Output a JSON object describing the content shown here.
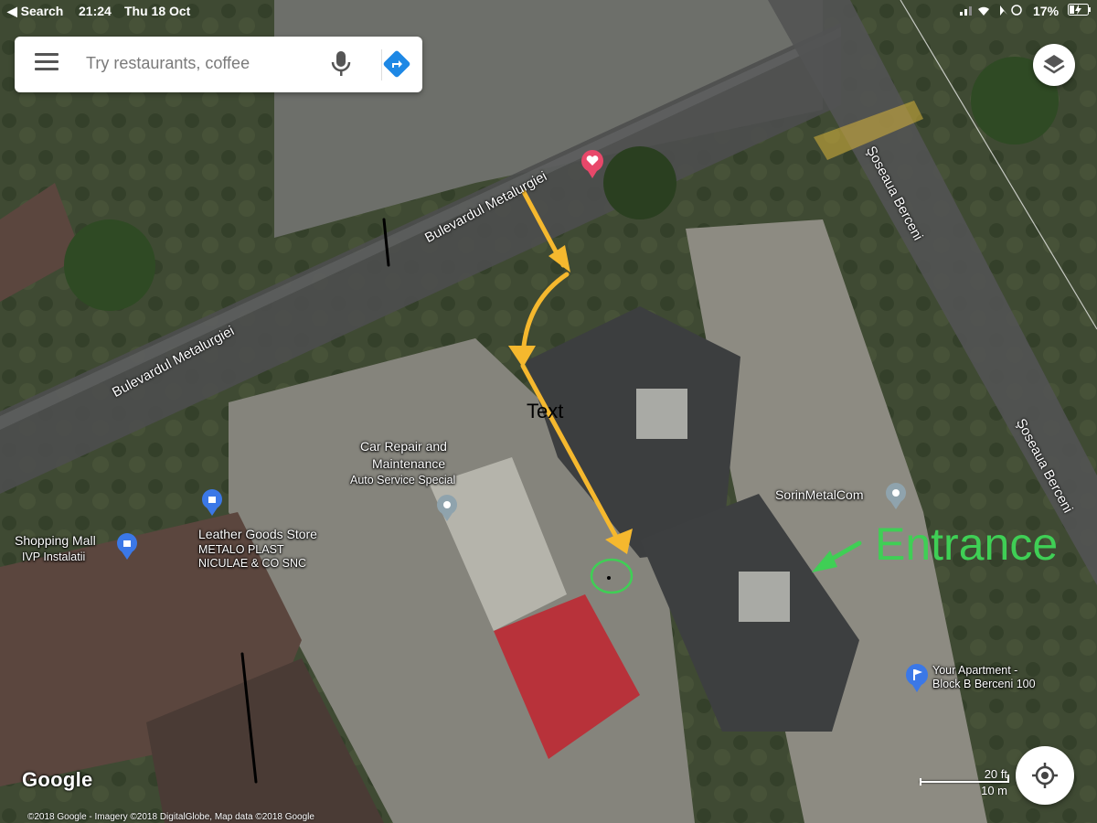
{
  "status_bar": {
    "back_label": "◀ Search",
    "time": "21:24",
    "date": "Thu 18 Oct",
    "battery": "17%"
  },
  "search": {
    "placeholder": "Try restaurants, coffee",
    "menu_icon": "hamburger-icon",
    "mic_icon": "microphone-icon",
    "directions_icon": "directions-icon"
  },
  "roads": {
    "metalurgiei_upper": "Bulevardul Metalurgiei",
    "metalurgiei_lower": "Bulevardul Metalurgiei",
    "berceni_upper": "Şoseaua Berceni",
    "berceni_lower": "Şoseaua Berceni"
  },
  "places": {
    "car_repair_title": "Car Repair and Maintenance",
    "car_repair_line1": "Car Repair and",
    "car_repair_line2": "Maintenance",
    "car_repair_sub": "Auto Service Special",
    "shopping_mall": "Shopping Mall",
    "shopping_sub": "IVP Instalatii",
    "leather_store": "Leather Goods Store",
    "leather_sub1": "METALO PLAST",
    "leather_sub2": "NICULAE & CO SNC",
    "sorin": "SorinMetalCom",
    "apartment_line1": "Your Apartment -",
    "apartment_line2": "Block B Berceni 100"
  },
  "annotations": {
    "text_label": "Text",
    "entrance_label": "Entrance",
    "arrow_color": "#f5b82e",
    "entrance_color": "#3fcf55",
    "circle_color": "#3fcf55"
  },
  "map_controls": {
    "layers_icon": "layers-icon",
    "locate_icon": "my-location-icon",
    "scale_ft": "20 ft",
    "scale_m": "10 m"
  },
  "branding": {
    "logo": "Google",
    "copyright": "©2018 Google - Imagery ©2018 DigitalGlobe, Map data ©2018 Google"
  },
  "colors": {
    "pin_gray": "#8fa3ad",
    "pin_blue": "#3b78e7",
    "pin_red": "#e8486a",
    "roof_red": "#b8323a"
  }
}
